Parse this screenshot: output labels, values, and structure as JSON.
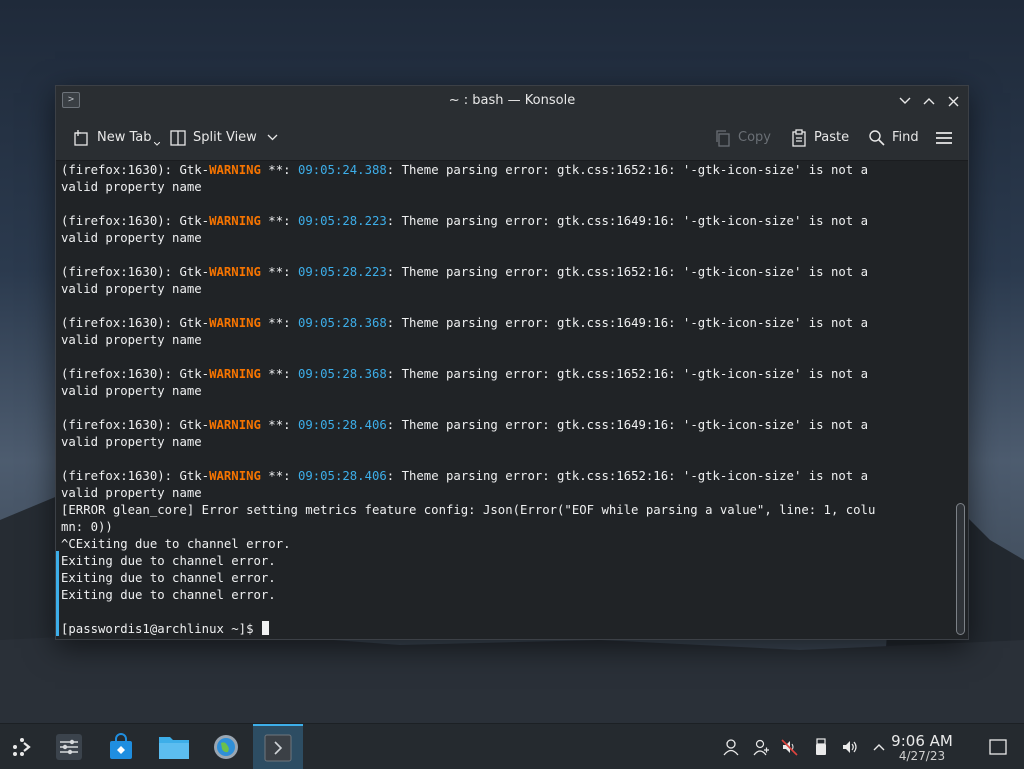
{
  "window": {
    "title": "~ : bash — Konsole"
  },
  "toolbar": {
    "new_tab": "New Tab",
    "split_view": "Split View",
    "copy": "Copy",
    "paste": "Paste",
    "find": "Find"
  },
  "terminal": {
    "prefix": "(firefox:1630): Gtk-",
    "warning": "WARNING",
    "stars": " **: ",
    "cont": "valid property name",
    "warnings": [
      {
        "ts": "09:05:24.388",
        "rest": ": Theme parsing error: gtk.css:1652:16: '-gtk-icon-size' is not a"
      },
      {
        "ts": "09:05:28.223",
        "rest": ": Theme parsing error: gtk.css:1649:16: '-gtk-icon-size' is not a"
      },
      {
        "ts": "09:05:28.223",
        "rest": ": Theme parsing error: gtk.css:1652:16: '-gtk-icon-size' is not a"
      },
      {
        "ts": "09:05:28.368",
        "rest": ": Theme parsing error: gtk.css:1649:16: '-gtk-icon-size' is not a"
      },
      {
        "ts": "09:05:28.368",
        "rest": ": Theme parsing error: gtk.css:1652:16: '-gtk-icon-size' is not a"
      },
      {
        "ts": "09:05:28.406",
        "rest": ": Theme parsing error: gtk.css:1649:16: '-gtk-icon-size' is not a"
      },
      {
        "ts": "09:05:28.406",
        "rest": ": Theme parsing error: gtk.css:1652:16: '-gtk-icon-size' is not a"
      }
    ],
    "tail": [
      "[ERROR glean_core] Error setting metrics feature config: Json(Error(\"EOF while parsing a value\", line: 1, colu",
      "mn: 0))",
      "^CExiting due to channel error.",
      "Exiting due to channel error.",
      "Exiting due to channel error.",
      "Exiting due to channel error."
    ],
    "prompt": "[passwordis1@archlinux ~]$ "
  },
  "taskbar": {
    "time": "9:06 AM",
    "date": "4/27/23"
  },
  "colors": {
    "warning": "#f67400",
    "timestamp": "#3daee9",
    "accent": "#3daee9"
  }
}
